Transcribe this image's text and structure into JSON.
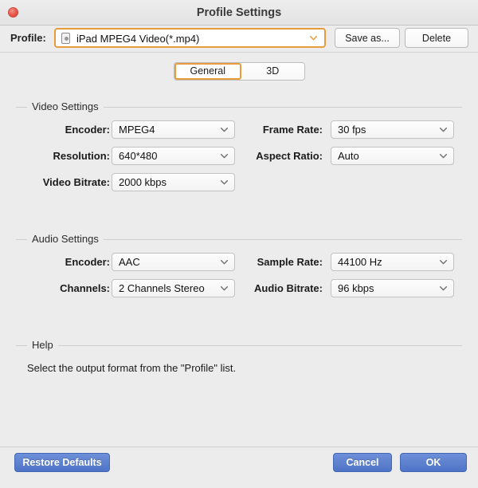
{
  "window": {
    "title": "Profile Settings",
    "close_icon": "close-icon",
    "accent_color": "#e89c3c",
    "button_blue": "#4f74c6",
    "background": "#ececec"
  },
  "profile_bar": {
    "label": "Profile:",
    "selected": "iPad MPEG4 Video(*.mp4)",
    "device_icon": "ipad-device-icon",
    "chevron_icon": "chevron-down-icon",
    "save_as_label": "Save as...",
    "delete_label": "Delete"
  },
  "tabs": [
    {
      "label": "General",
      "active": true
    },
    {
      "label": "3D",
      "active": false
    }
  ],
  "video_settings": {
    "legend": "Video Settings",
    "fields": [
      {
        "label": "Encoder:",
        "value": "MPEG4"
      },
      {
        "label": "Resolution:",
        "value": "640*480"
      },
      {
        "label": "Video Bitrate:",
        "value": "2000 kbps"
      },
      {
        "label": "Frame Rate:",
        "value": "30 fps"
      },
      {
        "label": "Aspect Ratio:",
        "value": "Auto"
      }
    ]
  },
  "audio_settings": {
    "legend": "Audio Settings",
    "fields": [
      {
        "label": "Encoder:",
        "value": "AAC"
      },
      {
        "label": "Channels:",
        "value": "2 Channels Stereo"
      },
      {
        "label": "Sample Rate:",
        "value": "44100 Hz"
      },
      {
        "label": "Audio Bitrate:",
        "value": "96 kbps"
      }
    ]
  },
  "help": {
    "legend": "Help",
    "text": "Select the output format from the \"Profile\" list."
  },
  "footer": {
    "restore_label": "Restore Defaults",
    "cancel_label": "Cancel",
    "ok_label": "OK"
  }
}
